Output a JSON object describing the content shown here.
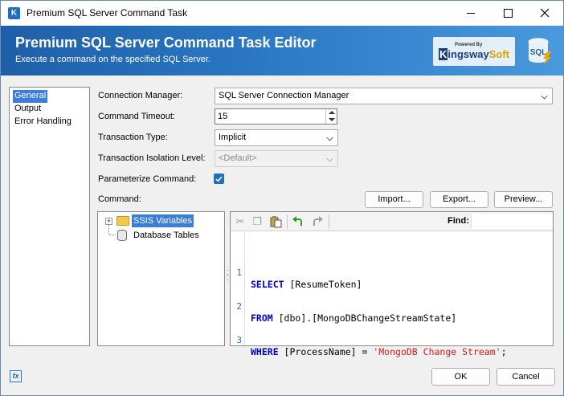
{
  "window": {
    "title": "Premium SQL Server Command Task"
  },
  "banner": {
    "title": "Premium SQL Server Command Task Editor",
    "subtitle": "Execute a command on the specified SQL Server.",
    "logo_powered": "Powered By",
    "logo_k": "K",
    "logo_ingsway": "ingsway",
    "logo_soft": "Soft",
    "sql_icon_text": "SQL"
  },
  "nav": {
    "items": [
      {
        "label": "General",
        "selected": true
      },
      {
        "label": "Output",
        "selected": false
      },
      {
        "label": "Error Handling",
        "selected": false
      }
    ]
  },
  "form": {
    "connection_manager_label": "Connection Manager:",
    "connection_manager_value": "SQL Server Connection Manager",
    "command_timeout_label": "Command Timeout:",
    "command_timeout_value": "15",
    "transaction_type_label": "Transaction Type:",
    "transaction_type_value": "Implicit",
    "isolation_label": "Transaction Isolation Level:",
    "isolation_value": "<Default>",
    "parameterize_label": "Parameterize Command:",
    "parameterize_checked": true,
    "command_label": "Command:",
    "import_label": "Import...",
    "export_label": "Export...",
    "preview_label": "Preview..."
  },
  "tree": {
    "items": [
      {
        "label": "SSIS Variables",
        "expander": "+",
        "selected": true,
        "icon": "folder-icon"
      },
      {
        "label": "Database Tables",
        "selected": false,
        "icon": "database-icon"
      }
    ]
  },
  "editor": {
    "toolbar": {
      "cut_icon": "cut-icon",
      "copy_icon": "copy-icon",
      "paste_icon": "paste-icon",
      "undo_icon": "undo-icon",
      "redo_icon": "redo-icon",
      "find_label": "Find:",
      "find_value": ""
    },
    "lines": [
      {
        "num": "1",
        "kw": "SELECT",
        "rest": " [ResumeToken]",
        "str": "",
        "end": ""
      },
      {
        "num": "2",
        "kw": "FROM",
        "rest": " [dbo].[MongoDBChangeStreamState]",
        "str": "",
        "end": ""
      },
      {
        "num": "3",
        "kw": "WHERE",
        "rest": " [ProcessName] = ",
        "str": "'MongoDB Change Stream'",
        "end": ";"
      }
    ]
  },
  "footer": {
    "fx_icon_text": "fx",
    "ok_label": "OK",
    "cancel_label": "Cancel"
  },
  "colors": {
    "banner_start": "#1f5fa8",
    "banner_end": "#4a99dc",
    "selection": "#3b7ddb",
    "keyword": "#0000cc",
    "string": "#d11d1d"
  }
}
